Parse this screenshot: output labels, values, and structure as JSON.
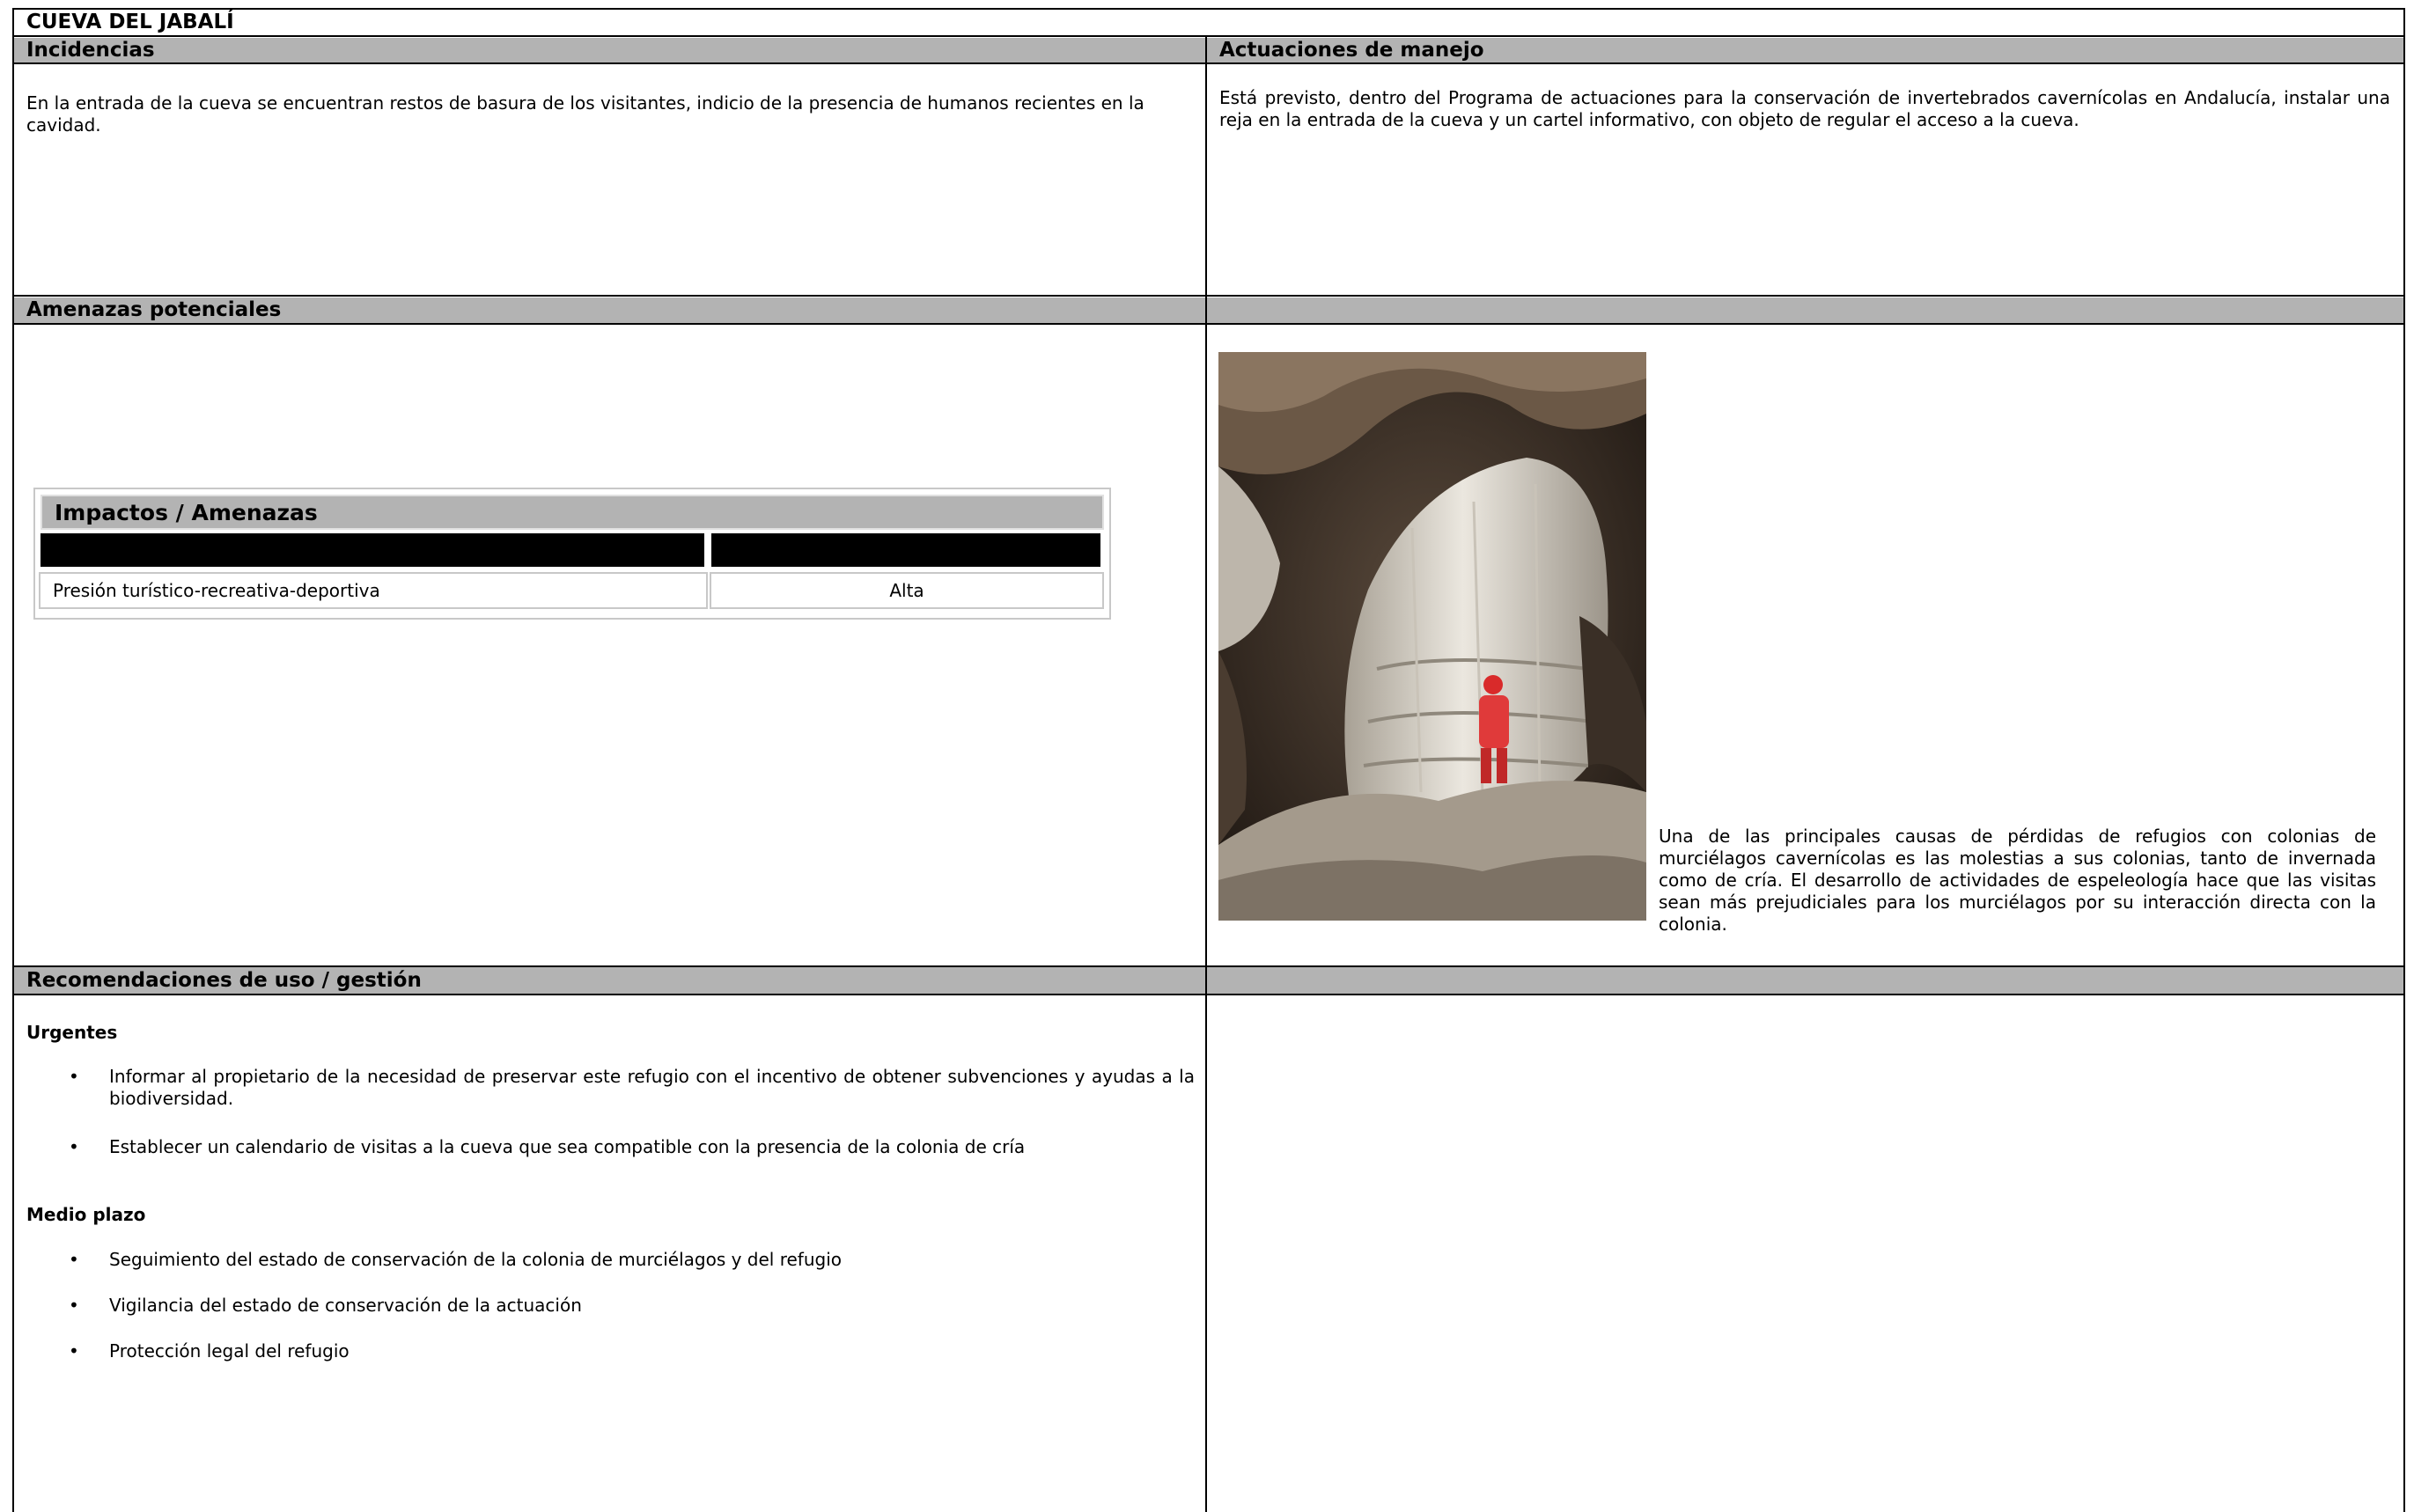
{
  "sheet": {
    "title": "CUEVA DEL JABALÍ"
  },
  "incidencias": {
    "heading": "Incidencias",
    "text": "En la entrada de la cueva se encuentran restos de basura de los visitantes, indicio de la presencia de humanos recientes en la cavidad."
  },
  "actuaciones": {
    "heading": "Actuaciones de manejo",
    "text": "Está previsto, dentro del Programa de actuaciones para la conservación de invertebrados cavernícolas en Andalucía, instalar una reja en la entrada de la cueva y un cartel informativo, con objeto de regular el acceso a la cueva."
  },
  "amenazas": {
    "heading": "Amenazas potenciales",
    "table": {
      "title": "Impactos / Amenazas",
      "rows": [
        {
          "impact": "Presión turístico-recreativa-deportiva",
          "level": "Alta"
        }
      ]
    },
    "photo": {
      "icon": "cave-stalagmite-photo",
      "caption": "Una de las principales causas de pérdidas de refugios con colonias de murciélagos cavernícolas es las molestias a sus colonias, tanto de invernada como de cría. El desarrollo de actividades de espeleología hace que las visitas sean más prejudiciales para los murciélagos por su interacción directa con la colonia."
    }
  },
  "recomendaciones": {
    "heading": "Recomendaciones de uso / gestión",
    "urgentes": {
      "label": "Urgentes",
      "items": [
        "Informar al propietario de la necesidad de preservar este refugio con el incentivo de obtener subvenciones y ayudas a la biodiversidad.",
        "Establecer un calendario de visitas a la cueva que sea compatible con la presencia de la colonia de cría"
      ]
    },
    "medio_plazo": {
      "label": "Medio plazo",
      "items": [
        "Seguimiento del estado de conservación de la colonia de murciélagos y del refugio",
        "Vigilancia del estado de conservación de la actuación",
        "Protección legal del refugio"
      ]
    }
  },
  "colors": {
    "header_band": "#b3b3b3",
    "border": "#000000",
    "impact_header": "#000000"
  }
}
